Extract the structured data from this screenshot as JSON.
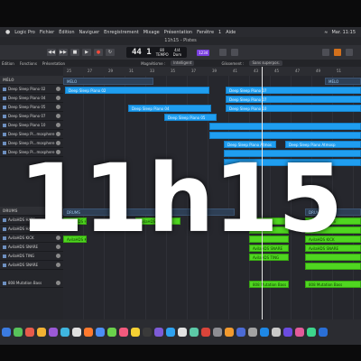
{
  "menubar": {
    "items": [
      "Logic Pro",
      "Fichier",
      "Édition",
      "Naviguer",
      "Enregistrement",
      "Mixage",
      "Présentation",
      "Fenêtre",
      "1",
      "Aide"
    ],
    "clock": "Mar. 11:15"
  },
  "window": {
    "title": "11h15 - Pistes"
  },
  "transport": {
    "bars": "44 1",
    "tempo": "80",
    "tempo_label": "TEMPO",
    "signature": "4/4",
    "key": "Dom",
    "key_badge": "1234"
  },
  "toolbar": {
    "edit": "Édition",
    "functions": "Fonctions",
    "view": "Présentation",
    "snap_label": "Magnétisme :",
    "snap_value": "Intelligent",
    "drag_label": "Glissement :",
    "drag_value": "Sans superpos."
  },
  "ruler": [
    "25",
    "27",
    "29",
    "31",
    "33",
    "35",
    "37",
    "39",
    "41",
    "43",
    "45",
    "47",
    "49",
    "51"
  ],
  "tracks": [
    {
      "label": "MÉLO",
      "header": true
    },
    {
      "label": "Deep Sleep Piano 02",
      "header": false
    },
    {
      "label": "Deep Sleep Piano 04",
      "header": false
    },
    {
      "label": "Deep Sleep Piano 05",
      "header": false
    },
    {
      "label": "Deep Sleep Piano 07",
      "header": false
    },
    {
      "label": "Deep Sleep Piano 10",
      "header": false
    },
    {
      "label": "Deep Sleep Pi...mosphere",
      "header": false
    },
    {
      "label": "Deep Sleep Pi...mosphere",
      "header": false
    },
    {
      "label": "Deep Sleep Pi...mosphere",
      "header": false
    },
    {
      "label": "DRUMS",
      "header": true
    },
    {
      "label": "AvilaHDS HATS",
      "header": false
    },
    {
      "label": "AvilaHDS HATS",
      "header": false
    },
    {
      "label": "AvilaHDS KICK",
      "header": false
    },
    {
      "label": "AvilaHDS SNARE",
      "header": false
    },
    {
      "label": "AvilaHDS TING",
      "header": false
    },
    {
      "label": "AvilaHDS SNARE",
      "header": false
    },
    {
      "label": "808 Mutation Bass",
      "header": false
    }
  ],
  "regions": {
    "melo_folder_1": "MÉLO",
    "melo_folder_2": "MÉLO",
    "piano_02": "Deep Sleep Piano 02",
    "piano_04": "Deep Sleep Piano 04",
    "piano_05": "Deep Sleep Piano 05",
    "piano_07a": "Deep Sleep Piano 07",
    "piano_07b": "Deep Sleep Piano 07",
    "piano_10": "Deep Sleep Piano 10",
    "atmos_1": "Deep Sleep Piano Atmos",
    "atmos_2": "Deep Sleep Piano Atmosp",
    "drums_folder_1": "DRUMS",
    "drums_folder_2": "DRUMS",
    "hats_1": "AvilaHDS HATS",
    "hats_2": "AvilaHDS HATS",
    "hats_3": "AvilaHDS T",
    "kick_1": "AvilaHDS KICK",
    "kick_2": "AvilaHDS KICK",
    "snare_1": "AvilaHDS SNARE",
    "snare_2": "AvilaHDS SNARE",
    "ting_1": "AvilaHDS TING",
    "bass_1": "808 Mutation Bass",
    "bass_2": "808 Mutation Bass"
  },
  "overlay_text": "11h15",
  "dock_colors": [
    "#3b7be0",
    "#57c25a",
    "#e65b4b",
    "#f2b233",
    "#9b59d6",
    "#3fb6e0",
    "#e0e0e0",
    "#ff7a2e",
    "#4c8ef5",
    "#6ad14b",
    "#f25a7d",
    "#f5d033",
    "#3a3a3a",
    "#7d5bd6",
    "#2ea2f0",
    "#e2e2e2",
    "#5cc9a7",
    "#d9443a",
    "#8e8e93",
    "#f29a2e",
    "#4b6bd6",
    "#a3a3a3",
    "#1e88e5",
    "#c9c9c9",
    "#6b4ce0",
    "#e35b9a",
    "#3dd68c",
    "#2a6fd6"
  ]
}
